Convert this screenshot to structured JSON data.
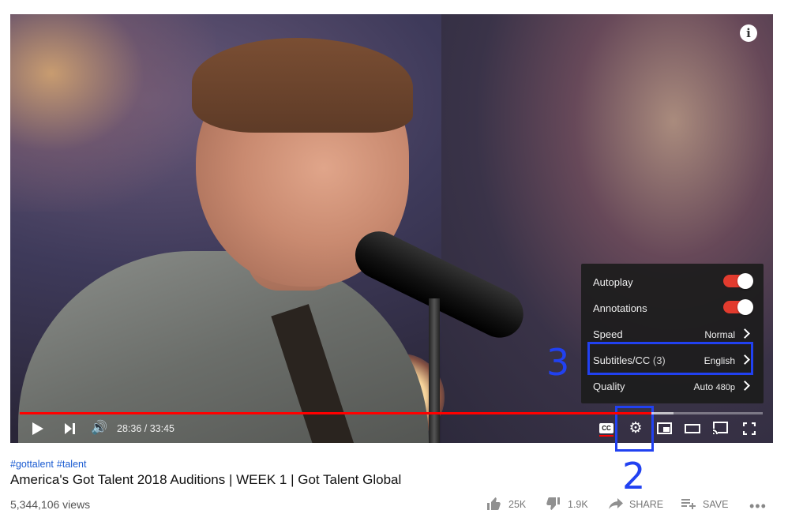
{
  "player": {
    "time": "28:36 / 33:45",
    "progress_fraction": 0.85,
    "buffered_fraction": 0.88,
    "cc_label": "CC"
  },
  "settings_menu": {
    "items": [
      {
        "label": "Autoplay",
        "type": "toggle",
        "on": true
      },
      {
        "label": "Annotations",
        "type": "toggle",
        "on": true
      },
      {
        "label": "Speed",
        "value": "Normal"
      },
      {
        "label": "Subtitles/CC",
        "count": "(3)",
        "value": "English"
      },
      {
        "label": "Quality",
        "value": "Auto",
        "sub": "480p"
      }
    ]
  },
  "annotations": {
    "label_2": "2",
    "label_3": "3",
    "color": "#2141f1"
  },
  "video": {
    "hashtags": [
      "#gottalent",
      "#talent"
    ],
    "title": "America's Got Talent 2018 Auditions | WEEK 1 | Got Talent Global",
    "views": "5,344,106 views"
  },
  "actions": {
    "likes": "25K",
    "dislikes": "1.9K",
    "share": "SHARE",
    "save": "SAVE"
  },
  "icons": [
    "info-icon",
    "play-icon",
    "next-icon",
    "volume-icon",
    "cc-icon",
    "gear-icon",
    "miniplayer-icon",
    "theater-icon",
    "cast-icon",
    "fullscreen-icon",
    "thumbs-up-icon",
    "thumbs-down-icon",
    "share-icon",
    "save-icon",
    "more-icon"
  ]
}
